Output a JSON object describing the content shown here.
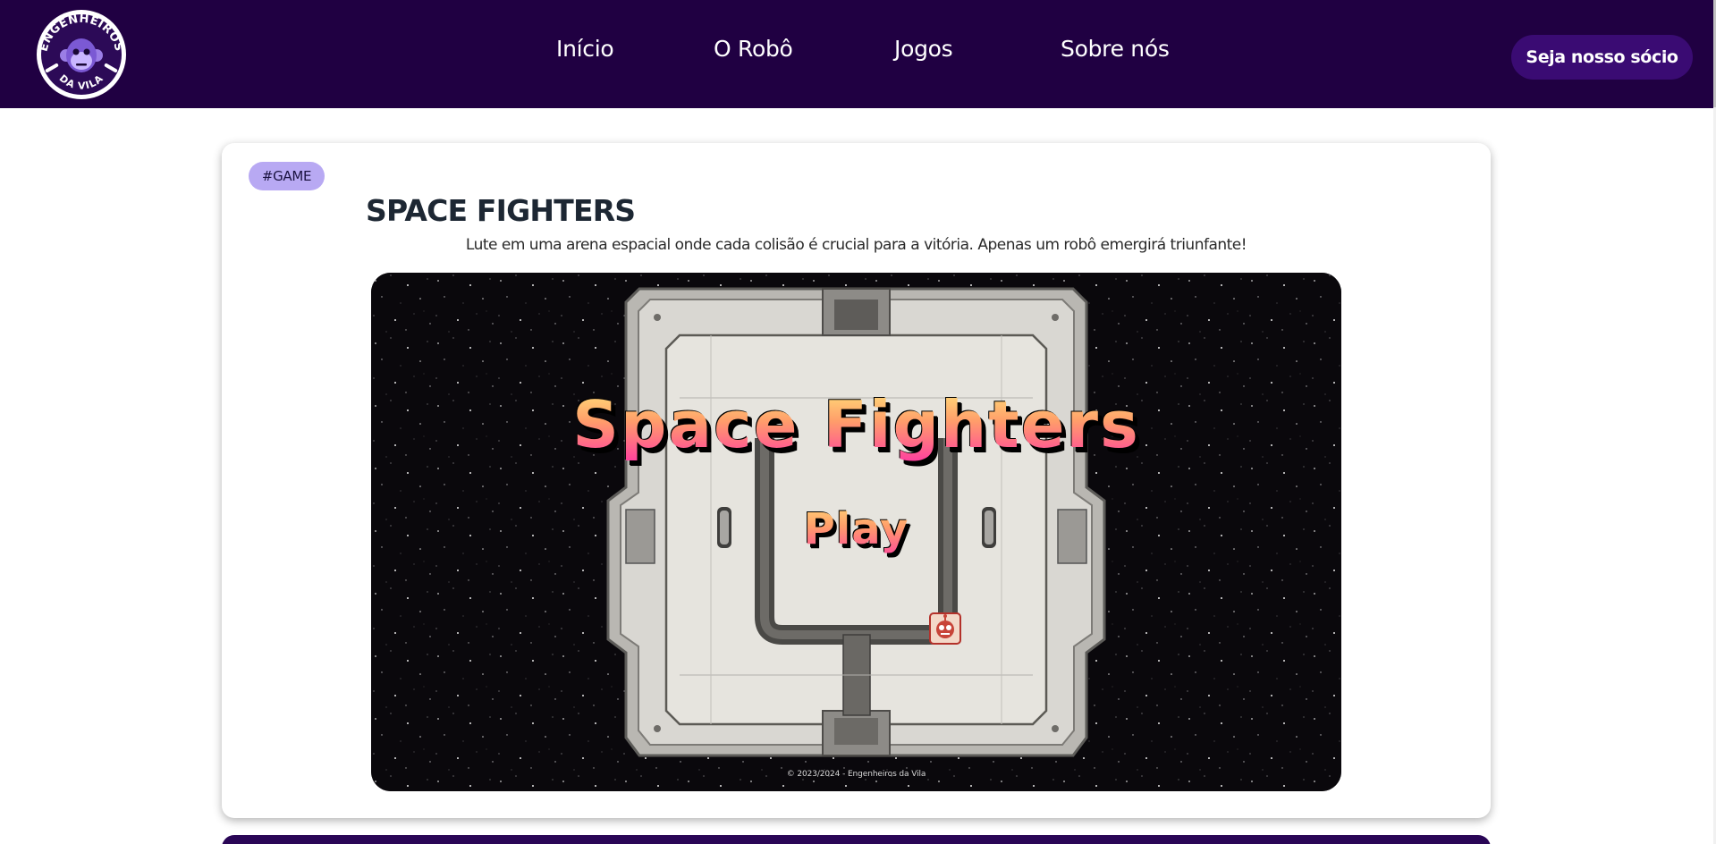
{
  "brand": {
    "logo_top_text": "ENGENHEIROS",
    "logo_bottom_text": "DA VILA"
  },
  "nav": {
    "items": [
      {
        "label": "Início"
      },
      {
        "label": "O Robô"
      },
      {
        "label": "Jogos"
      },
      {
        "label": "Sobre nós"
      }
    ]
  },
  "header": {
    "cta_label": "Seja nosso sócio"
  },
  "game_card": {
    "tag": "#GAME",
    "title": "SPACE FIGHTERS",
    "description": "Lute em uma arena espacial onde cada colisão é crucial para a vitória. Apenas um robô emergirá triunfante!",
    "screen": {
      "title": "Space Fighters",
      "play_label": "Play",
      "copyright": "© 2023/2024 - Engenheiros da Vila"
    }
  },
  "colors": {
    "header_bg": "#200042",
    "cta_bg": "#3a0b73",
    "tag_bg": "#b8a9f3",
    "title_gradient_top": "#ffe37a",
    "title_gradient_bottom": "#ff3fa0"
  },
  "icons": {
    "logo": "monkey-logo-icon",
    "robot": "robot-icon"
  }
}
